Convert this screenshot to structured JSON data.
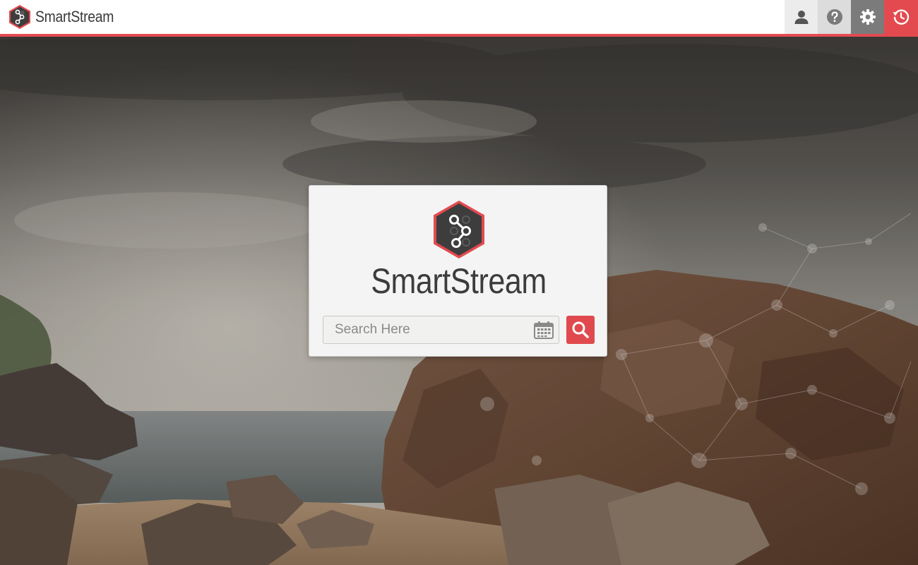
{
  "app": {
    "name": "SmartStream"
  },
  "header": {
    "icons": [
      "user-icon",
      "help-icon",
      "gear-icon",
      "history-icon"
    ],
    "accent_color": "#e34a4f"
  },
  "card": {
    "title": "SmartStream",
    "search": {
      "placeholder": "Search Here",
      "value": ""
    }
  },
  "colors": {
    "accent": "#e34a4f",
    "logo_hex": "#3d3d3d",
    "logo_border": "#e34a4f"
  }
}
